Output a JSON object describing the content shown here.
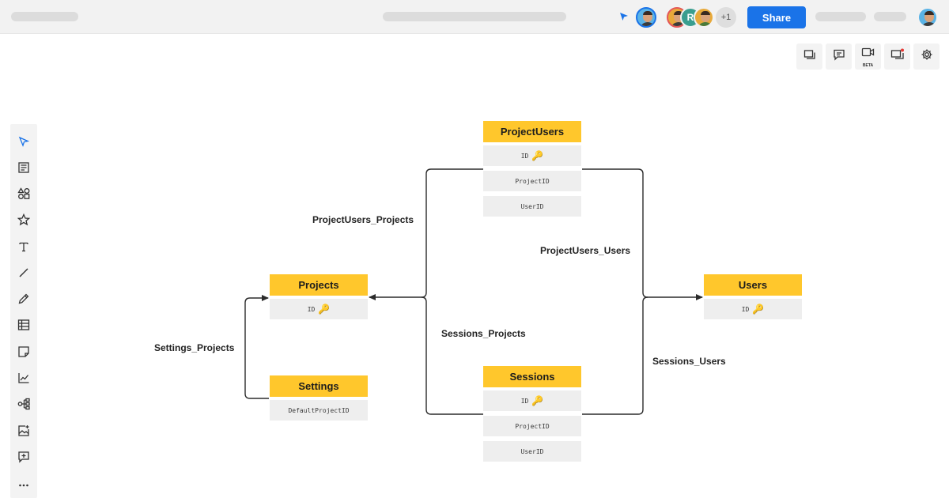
{
  "header": {
    "share_label": "Share",
    "collaborator_initial": "R",
    "extra_collaborators": "+1"
  },
  "toolbar_right": {
    "beta_badge": "BETA",
    "icons": [
      "frames-icon",
      "comment-icon",
      "video-icon",
      "presentation-icon",
      "gear-icon"
    ]
  },
  "left_toolbar": {
    "icons": [
      "select-icon",
      "text-block-icon",
      "shapes-icon",
      "star-icon",
      "text-icon",
      "line-icon",
      "pen-icon",
      "table-icon",
      "sticky-note-icon",
      "chart-icon",
      "mindmap-icon",
      "image-icon",
      "add-frame-icon",
      "more-icon"
    ]
  },
  "diagram": {
    "entities": {
      "projectusers": {
        "name": "ProjectUsers",
        "fields": [
          "ID",
          "ProjectID",
          "UserID"
        ]
      },
      "projects": {
        "name": "Projects",
        "fields": [
          "ID"
        ]
      },
      "users": {
        "name": "Users",
        "fields": [
          "ID"
        ]
      },
      "settings": {
        "name": "Settings",
        "fields": [
          "DefaultProjectID"
        ]
      },
      "sessions": {
        "name": "Sessions",
        "fields": [
          "ID",
          "ProjectID",
          "UserID"
        ]
      }
    },
    "relationships": {
      "projectusers_projects": "ProjectUsers_Projects",
      "projectusers_users": "ProjectUsers_Users",
      "sessions_projects": "Sessions_Projects",
      "sessions_users": "Sessions_Users",
      "settings_projects": "Settings_Projects"
    },
    "key_icon": "key-icon",
    "colors": {
      "header": "#ffc72c",
      "field": "#eeeeee",
      "line": "#2b2b2b"
    }
  }
}
